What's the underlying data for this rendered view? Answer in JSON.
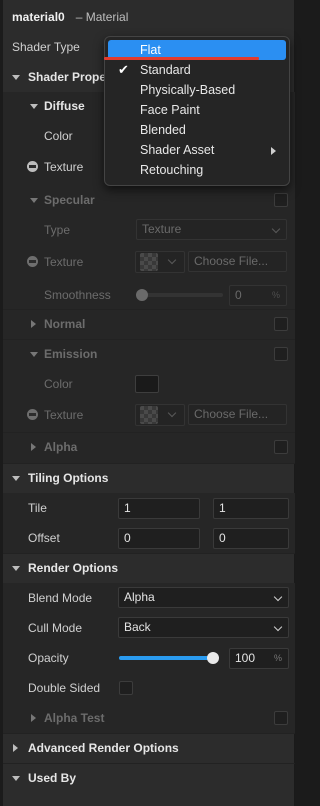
{
  "header": {
    "material_name": "material0",
    "subtitle": "– Material"
  },
  "shader_type": {
    "label": "Shader Type",
    "menu": [
      {
        "label": "Flat",
        "highlighted": true,
        "checked": false,
        "submenu": false
      },
      {
        "label": "Standard",
        "highlighted": false,
        "checked": true,
        "submenu": false
      },
      {
        "label": "Physically-Based",
        "highlighted": false,
        "checked": false,
        "submenu": false
      },
      {
        "label": "Face Paint",
        "highlighted": false,
        "checked": false,
        "submenu": false
      },
      {
        "label": "Blended",
        "highlighted": false,
        "checked": false,
        "submenu": false
      },
      {
        "label": "Shader Asset",
        "highlighted": false,
        "checked": false,
        "submenu": true
      },
      {
        "label": "Retouching",
        "highlighted": false,
        "checked": false,
        "submenu": false
      }
    ],
    "check_glyph": "✔"
  },
  "shader_properties": {
    "title": "Shader Proper",
    "diffuse": {
      "title": "Diffuse",
      "color_label": "Color",
      "texture_label": "Texture"
    },
    "specular": {
      "title": "Specular",
      "type_label": "Type",
      "type_value": "Texture",
      "texture_label": "Texture",
      "choose_file": "Choose File...",
      "smoothness_label": "Smoothness",
      "smoothness_value": "0",
      "smoothness_unit": "%"
    },
    "normal": {
      "title": "Normal"
    },
    "emission": {
      "title": "Emission",
      "color_label": "Color",
      "texture_label": "Texture",
      "choose_file": "Choose File..."
    },
    "alpha": {
      "title": "Alpha"
    }
  },
  "tiling_options": {
    "title": "Tiling Options",
    "tile_label": "Tile",
    "tile_x": "1",
    "tile_y": "1",
    "offset_label": "Offset",
    "offset_x": "0",
    "offset_y": "0"
  },
  "render_options": {
    "title": "Render Options",
    "blend_mode_label": "Blend Mode",
    "blend_mode_value": "Alpha",
    "cull_mode_label": "Cull Mode",
    "cull_mode_value": "Back",
    "opacity_label": "Opacity",
    "opacity_value": "100",
    "opacity_unit": "%",
    "opacity_fraction": 1.0,
    "double_sided_label": "Double Sided",
    "alpha_test_label": "Alpha Test"
  },
  "advanced_render_options": {
    "title": "Advanced Render Options"
  },
  "used_by": {
    "title": "Used By"
  },
  "colors": {
    "accent": "#2b8ff2",
    "annotation": "#e23b2e",
    "panel": "#2c2c2c"
  }
}
